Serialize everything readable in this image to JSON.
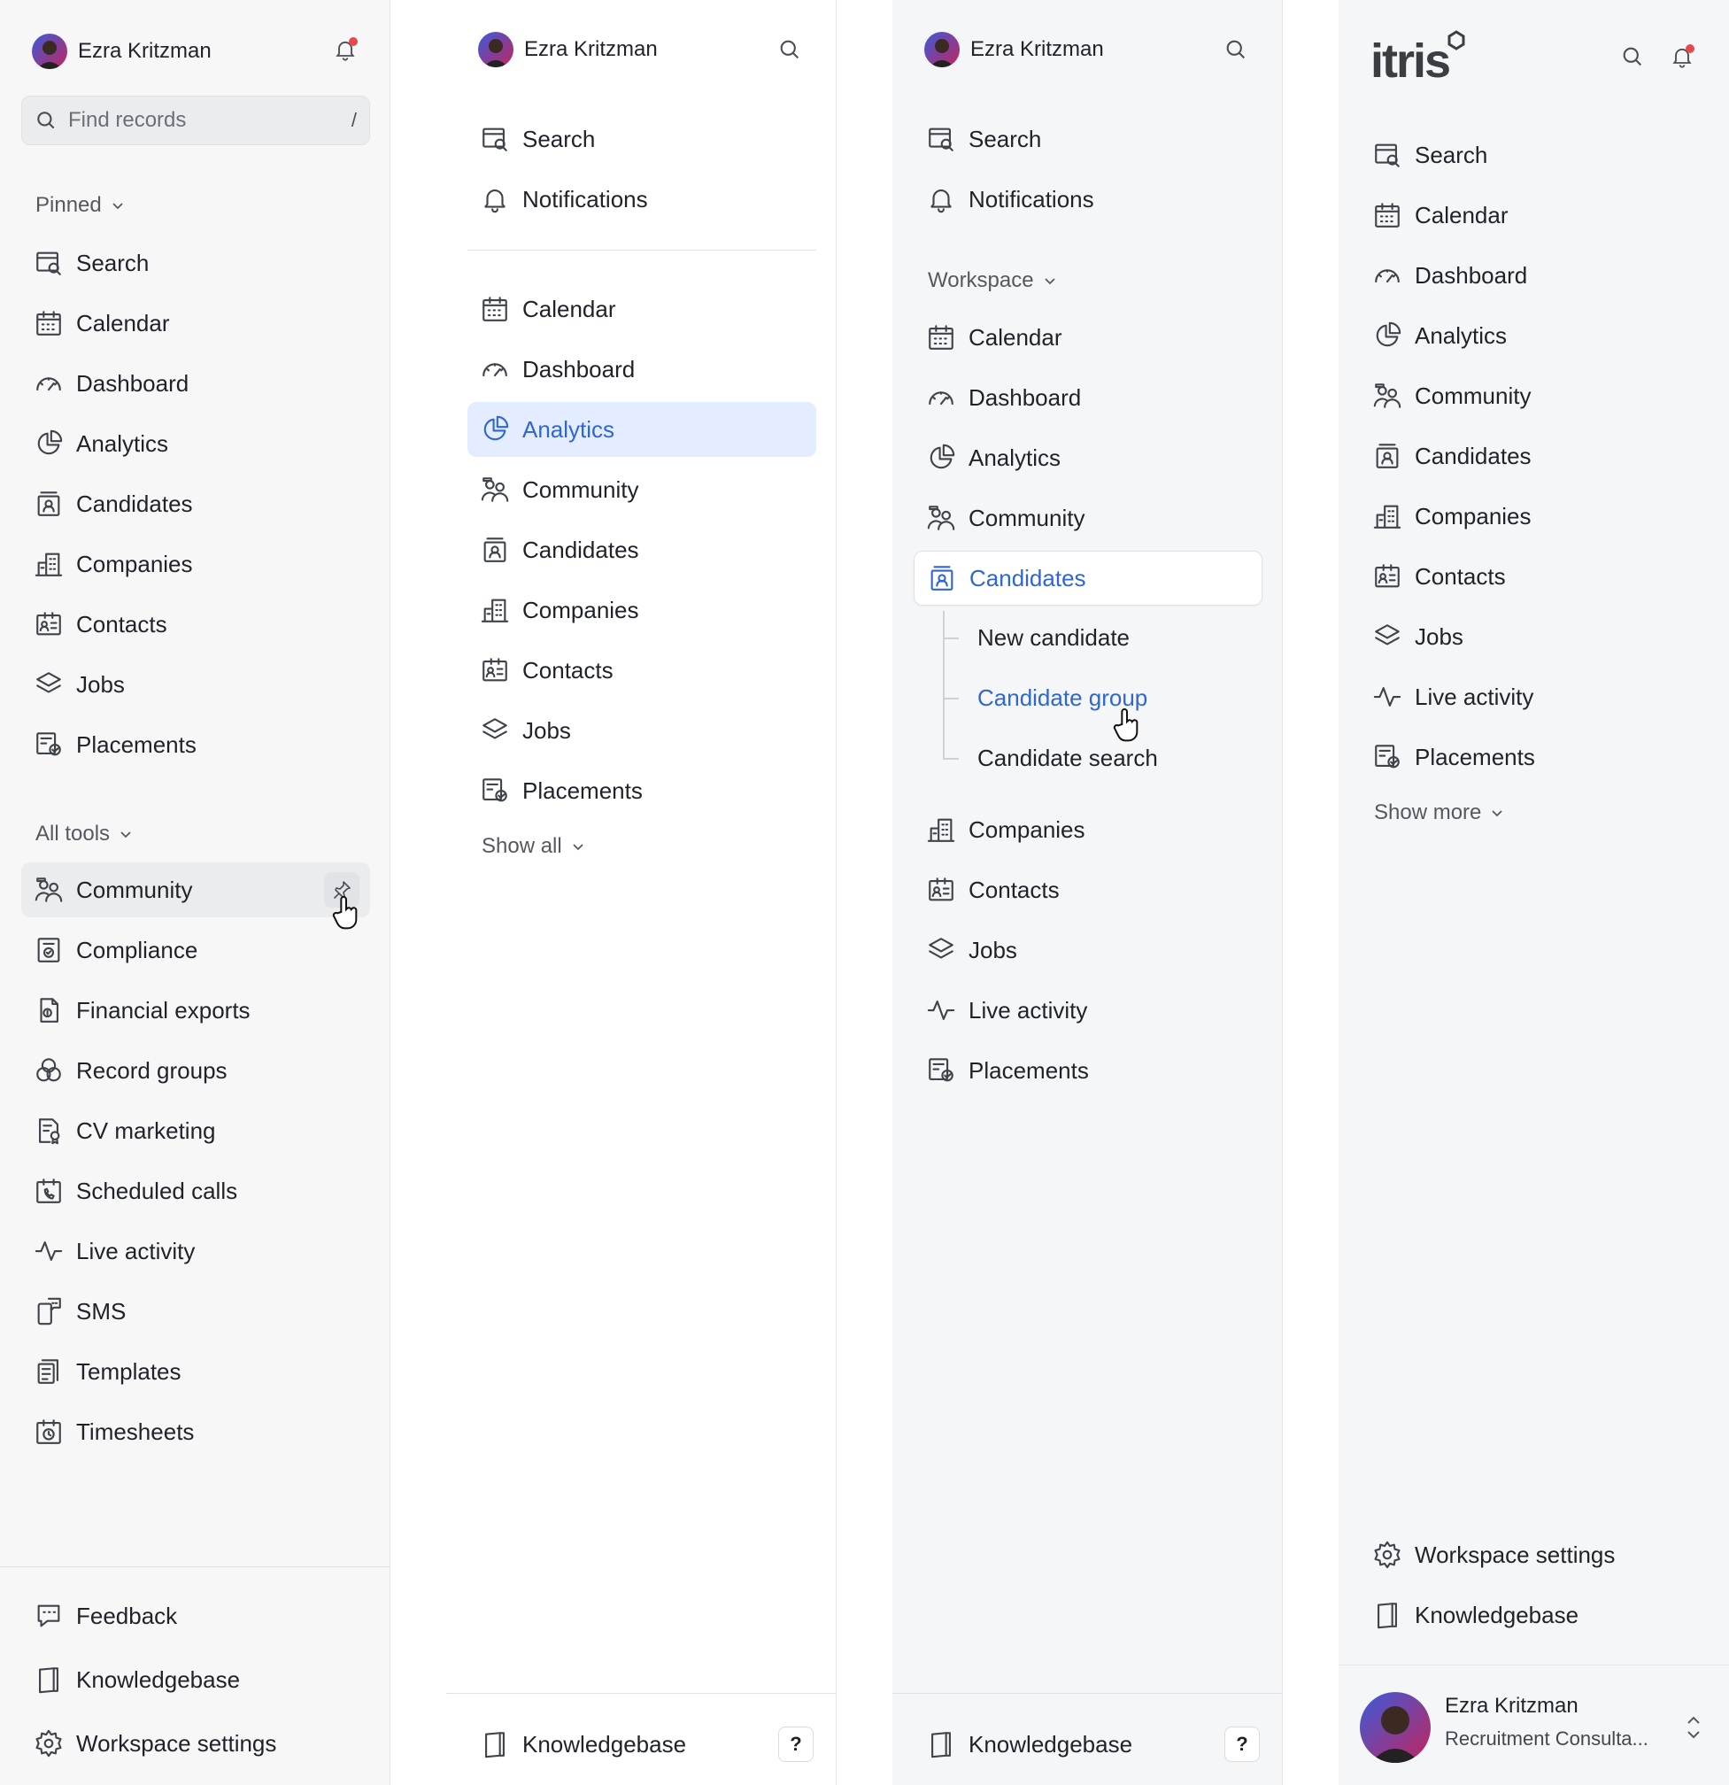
{
  "user": {
    "name": "Ezra Kritzman",
    "role": "Recruitment Consulta..."
  },
  "panel1": {
    "search_placeholder": "Find records",
    "search_shortcut": "/",
    "pinned_label": "Pinned",
    "pinned_items": [
      "Search",
      "Calendar",
      "Dashboard",
      "Analytics",
      "Candidates",
      "Companies",
      "Contacts",
      "Jobs",
      "Placements"
    ],
    "all_tools_label": "All tools",
    "tools": [
      "Community",
      "Compliance",
      "Financial exports",
      "Record groups",
      "CV marketing",
      "Scheduled calls",
      "Live activity",
      "SMS",
      "Templates",
      "Timesheets"
    ],
    "footer": [
      "Feedback",
      "Knowledgebase",
      "Workspace settings"
    ]
  },
  "panel2": {
    "top_items": [
      "Search",
      "Notifications"
    ],
    "items": [
      "Calendar",
      "Dashboard",
      "Analytics",
      "Community",
      "Candidates",
      "Companies",
      "Contacts",
      "Jobs",
      "Placements"
    ],
    "active": "Analytics",
    "show_all": "Show all",
    "footer": "Knowledgebase",
    "help": "?"
  },
  "panel3": {
    "top_items": [
      "Search",
      "Notifications"
    ],
    "workspace_label": "Workspace",
    "items_a": [
      "Calendar",
      "Dashboard",
      "Analytics",
      "Community",
      "Candidates"
    ],
    "sub_items": [
      "New candidate",
      "Candidate group",
      "Candidate search"
    ],
    "items_b": [
      "Companies",
      "Contacts",
      "Jobs",
      "Live activity",
      "Placements"
    ],
    "footer": "Knowledgebase",
    "help": "?"
  },
  "panel4": {
    "logo": "itris",
    "items": [
      "Search",
      "Calendar",
      "Dashboard",
      "Analytics",
      "Community",
      "Candidates",
      "Companies",
      "Contacts",
      "Jobs",
      "Live activity",
      "Placements"
    ],
    "show_more": "Show more",
    "footer": [
      "Workspace settings",
      "Knowledgebase"
    ]
  },
  "colors": {
    "accent": "#2f66d0",
    "active_bg": "#e3edff",
    "badge": "#e5484d"
  }
}
